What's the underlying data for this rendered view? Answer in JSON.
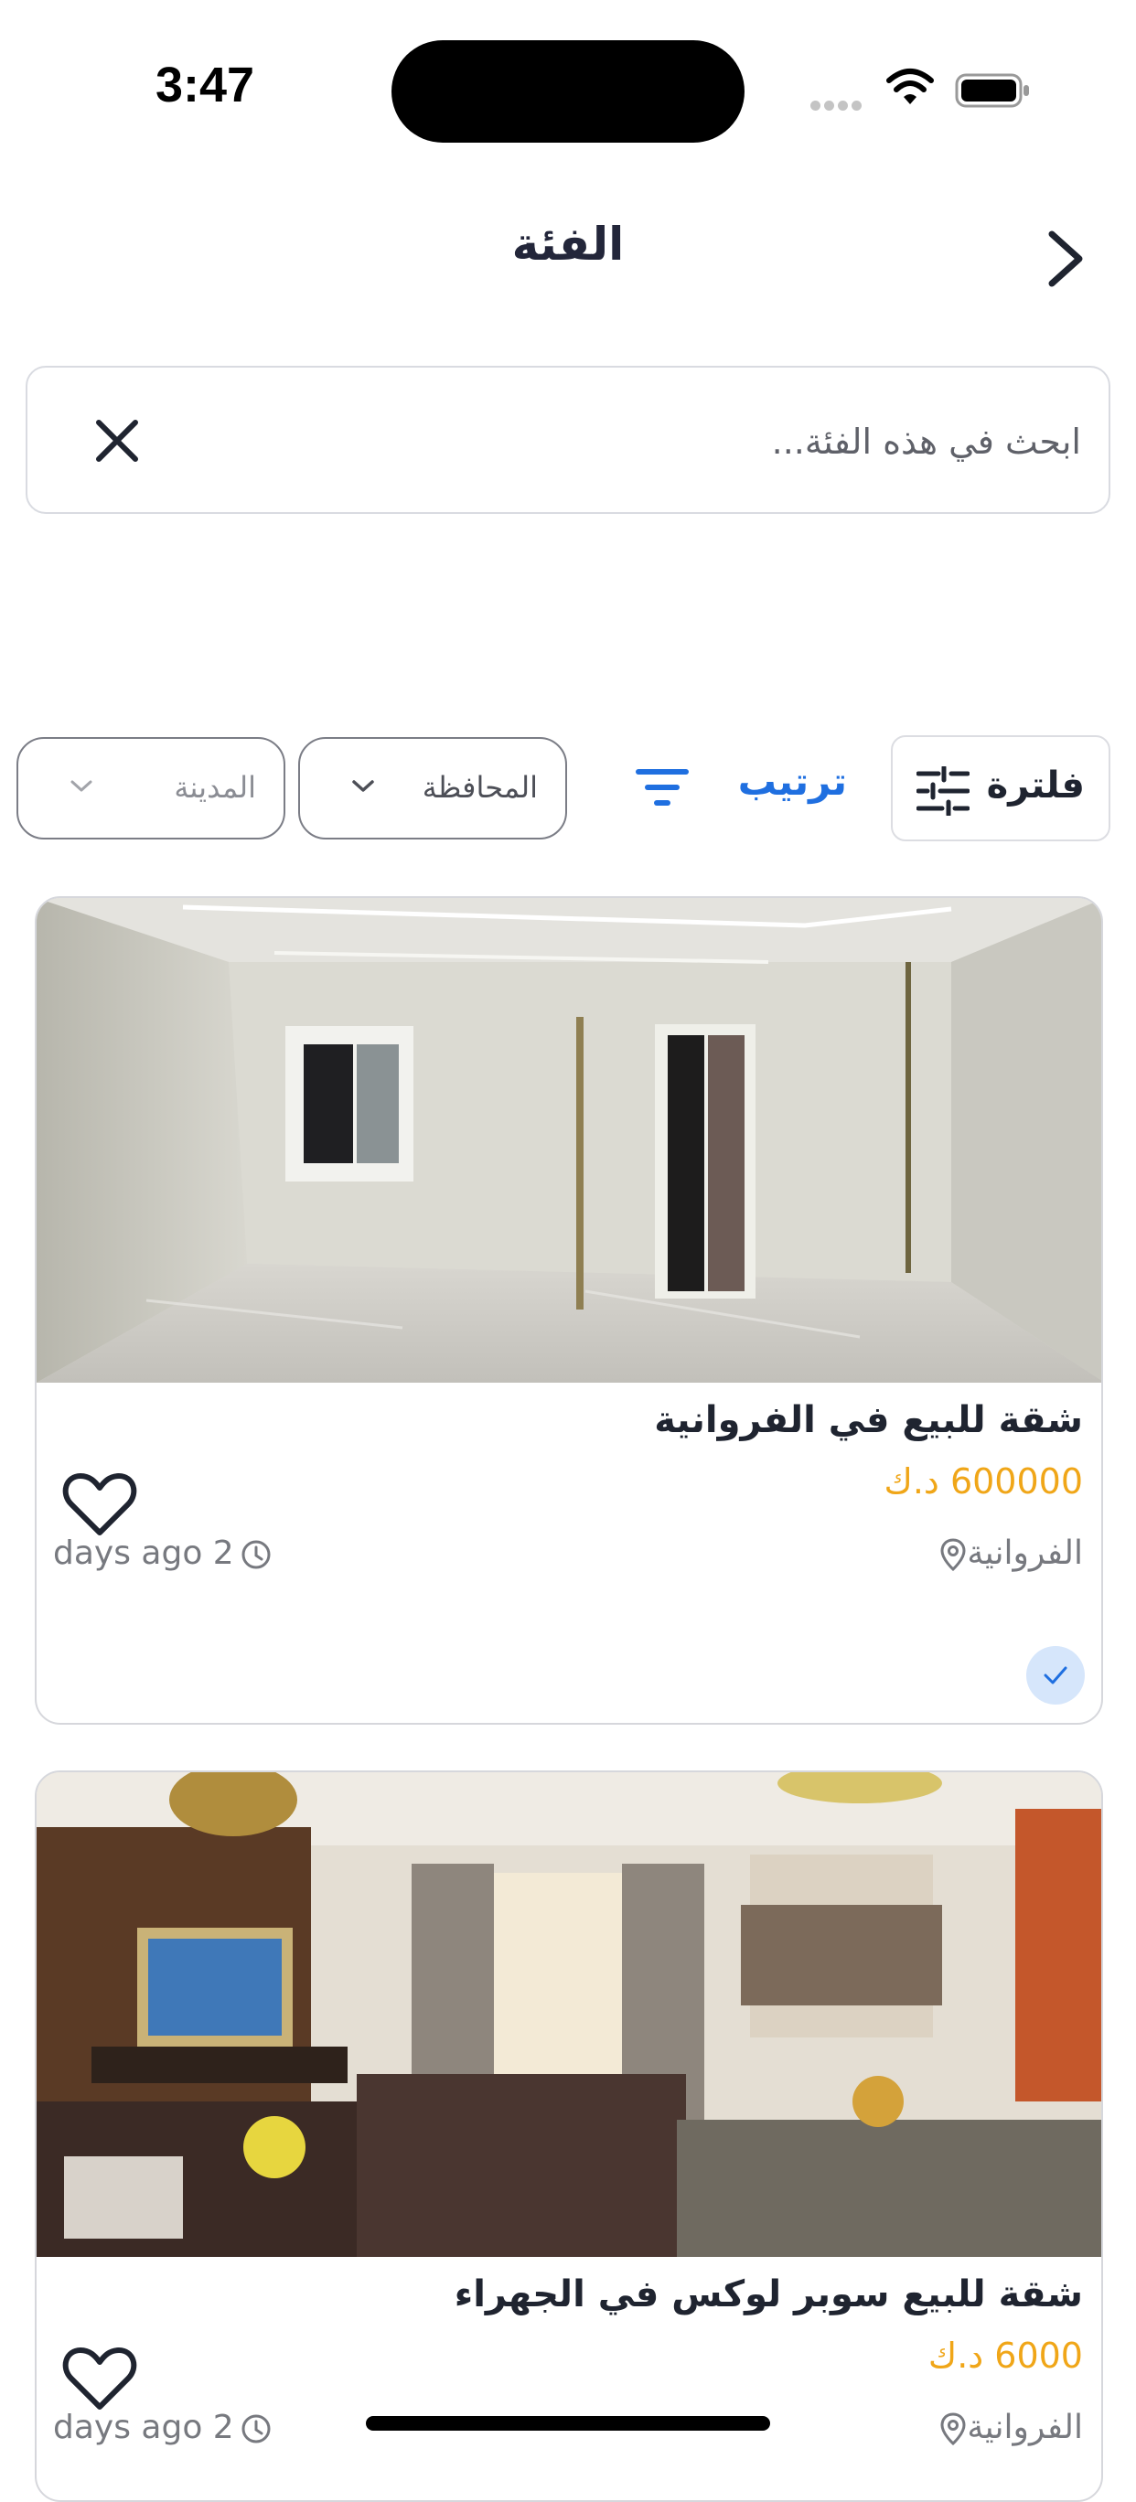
{
  "status_bar": {
    "time": "3:47"
  },
  "header": {
    "title": "الفئة",
    "back_icon": "chevron-right-icon"
  },
  "search": {
    "placeholder": "ابحث في هذه الفئة...",
    "value": "",
    "clear_icon": "close-icon"
  },
  "toolbar": {
    "filter_label": "فلترة",
    "filter_icon": "sliders-icon",
    "sort_label": "ترتيب",
    "sort_icon": "sort-lines-icon",
    "province_select": "المحافظة",
    "city_select": "المدينة",
    "accent_color": "#1f6fe0"
  },
  "listings": [
    {
      "title": "شقة للبيع في الفروانية",
      "price": "600000 د.ك",
      "location": "الفروانية",
      "time_ago": "days ago 2",
      "verified": true,
      "image": "empty-white-room-photo"
    },
    {
      "title": "شقة للبيع سوبر لوكس في الجهراء",
      "price": "6000 د.ك",
      "location": "الفروانية",
      "time_ago": "days ago 2",
      "verified": false,
      "image": "furnished-living-room-photo"
    }
  ],
  "colors": {
    "price": "#f0a618",
    "verified_badge": "#d6e6fb",
    "border": "#d6d7dc"
  }
}
